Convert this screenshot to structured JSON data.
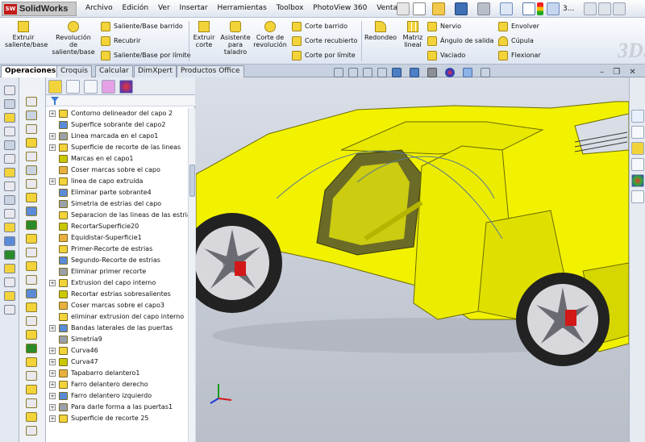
{
  "app": {
    "name": "SolidWorks",
    "logo_mark": "SW"
  },
  "menu": [
    "Archivo",
    "Edición",
    "Ver",
    "Insertar",
    "Herramientas",
    "Toolbox",
    "PhotoView 360",
    "Ventana"
  ],
  "quick_tools": {
    "overflow_label": "3..."
  },
  "command_manager": {
    "extrude_boss": "Extruir saliente/base",
    "revolve_boss": "Revolución de saliente/base",
    "swept_boss": "Saliente/Base barrido",
    "trim": "Recubrir",
    "boundary_boss": "Saliente/Base por límite",
    "extrude_cut": "Extruir corte",
    "hole_wizard": "Asistente para taladro",
    "revolve_cut": "Corte de revolución",
    "swept_cut": "Corte barrido",
    "lofted_cut": "Corte recubierto",
    "boundary_cut": "Corte por límite",
    "fillet": "Redondeo",
    "linear_pattern": "Matriz lineal",
    "rib": "Nervio",
    "draft": "Ángulo de salida",
    "shell": "Vaciado",
    "wrap": "Envolver",
    "dome": "Cúpula",
    "flex": "Flexionar"
  },
  "tabs": [
    "Operaciones",
    "Croquis",
    "Calcular",
    "DimXpert",
    "Productos Office"
  ],
  "feature_tree": [
    {
      "label": "Contorno delineador del capo 2",
      "expandable": true
    },
    {
      "label": "Superfice sobrante del capo2",
      "expandable": false
    },
    {
      "label": "Linea marcada en el capo1",
      "expandable": true
    },
    {
      "label": "Superficie de recorte de las lineas",
      "expandable": true
    },
    {
      "label": "Marcas en el capo1",
      "expandable": false
    },
    {
      "label": "Coser marcas sobre el capo",
      "expandable": false
    },
    {
      "label": "linea de capo extruida",
      "expandable": true
    },
    {
      "label": "Eliminar parte sobrante4",
      "expandable": false
    },
    {
      "label": "Simetria de estrias del capo",
      "expandable": false
    },
    {
      "label": "Separacion de las lineas de las estrias",
      "expandable": false
    },
    {
      "label": "RecortarSuperficie20",
      "expandable": false
    },
    {
      "label": "Equidistar-Superficie1",
      "expandable": false
    },
    {
      "label": "Primer-Recorte de estrias",
      "expandable": false
    },
    {
      "label": "Segundo-Recorte de estrias",
      "expandable": false
    },
    {
      "label": "Eliminar primer recorte",
      "expandable": false
    },
    {
      "label": "Extrusion del capo interno",
      "expandable": true
    },
    {
      "label": "Recortar estrias sobresalientes",
      "expandable": false
    },
    {
      "label": "Coser marcas sobre el capo3",
      "expandable": false
    },
    {
      "label": "eliminar extrusion del capo interno",
      "expandable": false
    },
    {
      "label": "Bandas laterales de las puertas",
      "expandable": true
    },
    {
      "label": "Simetria9",
      "expandable": false
    },
    {
      "label": "Curva46",
      "expandable": true
    },
    {
      "label": "Curva47",
      "expandable": true
    },
    {
      "label": "Tapabarro delantero1",
      "expandable": true
    },
    {
      "label": "Farro delantero derecho",
      "expandable": true
    },
    {
      "label": "Farro delantero izquierdo",
      "expandable": true
    },
    {
      "label": "Para darle forma a las puertas1",
      "expandable": true
    },
    {
      "label": "Superficie de recorte 25",
      "expandable": true
    }
  ],
  "colors": {
    "car_body": "#f2f200",
    "accent_blue": "#3a7bd5",
    "brake_red": "#d21818"
  }
}
